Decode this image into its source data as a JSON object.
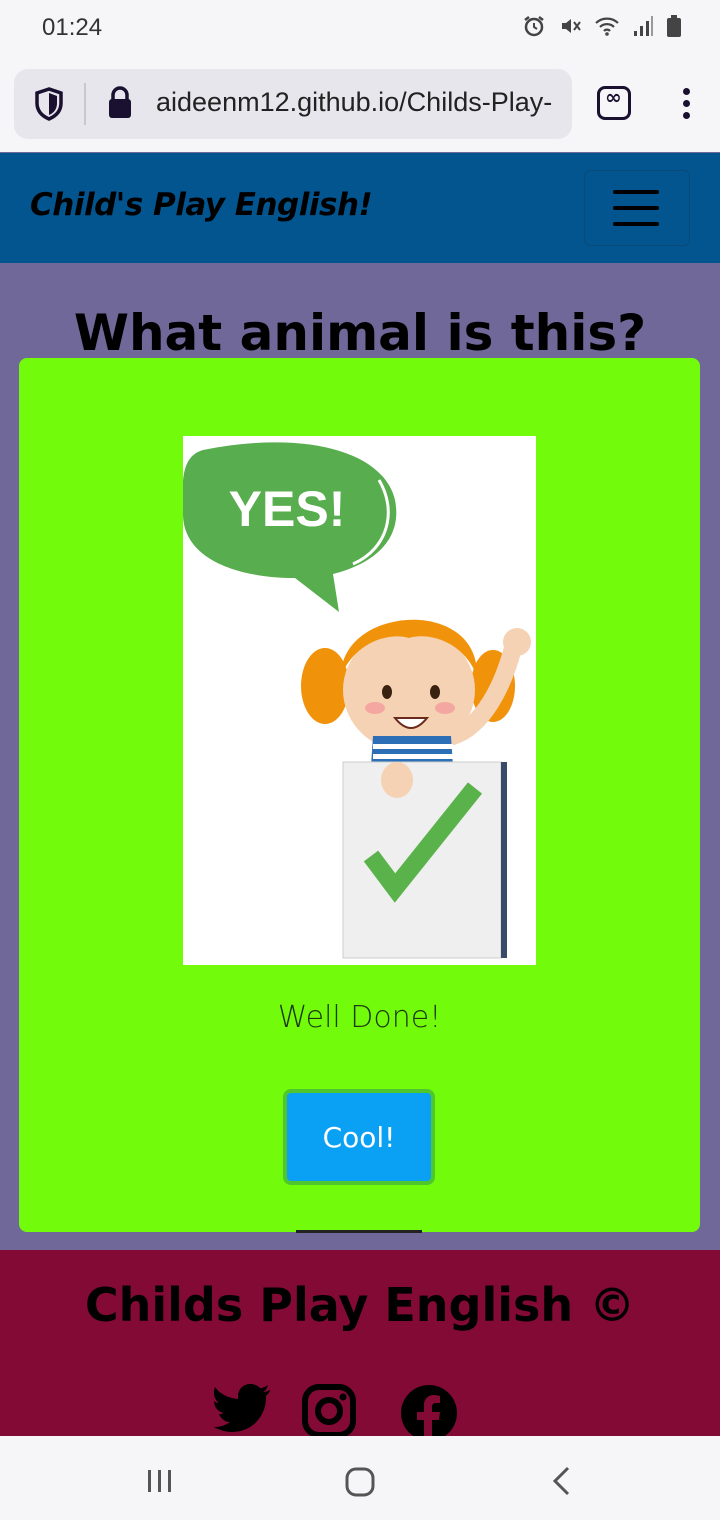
{
  "status_bar": {
    "time": "01:24"
  },
  "browser": {
    "url": "aideenm12.github.io/Childs-Play-",
    "icons": [
      "shield-icon",
      "lock-icon",
      "tab-switcher-icon",
      "more-menu-icon"
    ]
  },
  "navbar": {
    "brand": "Child's Play English!"
  },
  "page": {
    "title": "What animal is this?"
  },
  "modal": {
    "image_text": "YES!",
    "message": "Well Done!",
    "button_label": "Cool!"
  },
  "footer": {
    "title": "Childs Play English ©",
    "social": [
      "twitter-icon",
      "instagram-icon",
      "facebook-icon"
    ]
  },
  "colors": {
    "navbar": "#03558f",
    "page_bg": "#6f6898",
    "modal_bg": "#72fb0b",
    "button": "#0aa0f3",
    "footer": "#820a35"
  }
}
